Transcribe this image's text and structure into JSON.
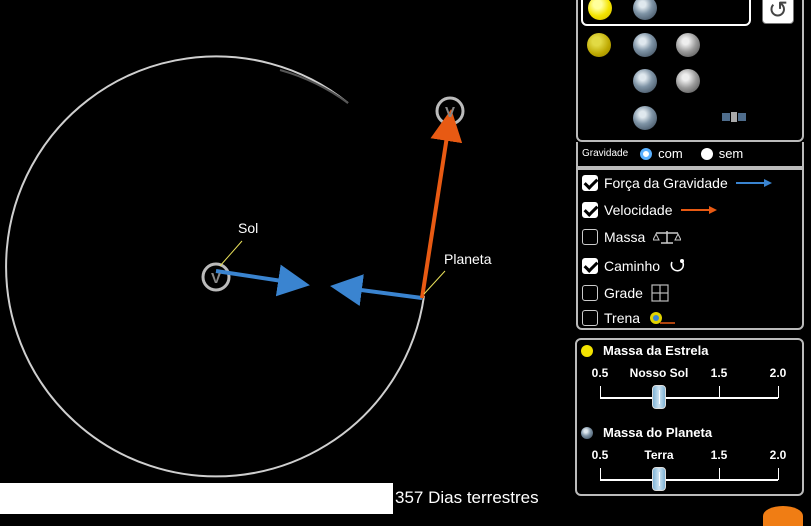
{
  "simulation": {
    "sun_label": "Sol",
    "planet_label": "Planeta",
    "velocity_marker": "V",
    "days_text": "357 Dias terrestres",
    "colors": {
      "gravity_vector": "#3a84d0",
      "velocity_vector": "#e85a13",
      "orbit": "#cfcfcf"
    }
  },
  "bodies_panel": {
    "icons": [
      "star-icon",
      "planet-icon",
      "star-icon",
      "planet-icon",
      "moon-icon",
      "planet-icon",
      "moon-icon",
      "planet-icon",
      "satellite-icon"
    ],
    "reset_icon": "reset-icon"
  },
  "gravity": {
    "label": "Gravidade",
    "options": [
      "com",
      "sem"
    ],
    "selected": "com"
  },
  "options": [
    {
      "label": "Força da Gravidade",
      "checked": true,
      "icon": "blue-arrow-icon"
    },
    {
      "label": "Velocidade",
      "checked": true,
      "icon": "orange-arrow-icon"
    },
    {
      "label": "Massa",
      "checked": false,
      "icon": "scale-icon"
    },
    {
      "label": "Caminho",
      "checked": true,
      "icon": "path-icon"
    },
    {
      "label": "Grade",
      "checked": false,
      "icon": "grid-icon"
    },
    {
      "label": "Trena",
      "checked": false,
      "icon": "tape-measure-icon"
    }
  ],
  "mass_controls": {
    "star": {
      "title": "Massa da Estrela",
      "ticks": [
        "0.5",
        "Nosso Sol",
        "1.5",
        "2.0"
      ],
      "value": 1.0
    },
    "planet": {
      "title": "Massa do Planeta",
      "ticks": [
        "0.5",
        "Terra",
        "1.5",
        "2.0"
      ],
      "value": 1.0
    }
  }
}
